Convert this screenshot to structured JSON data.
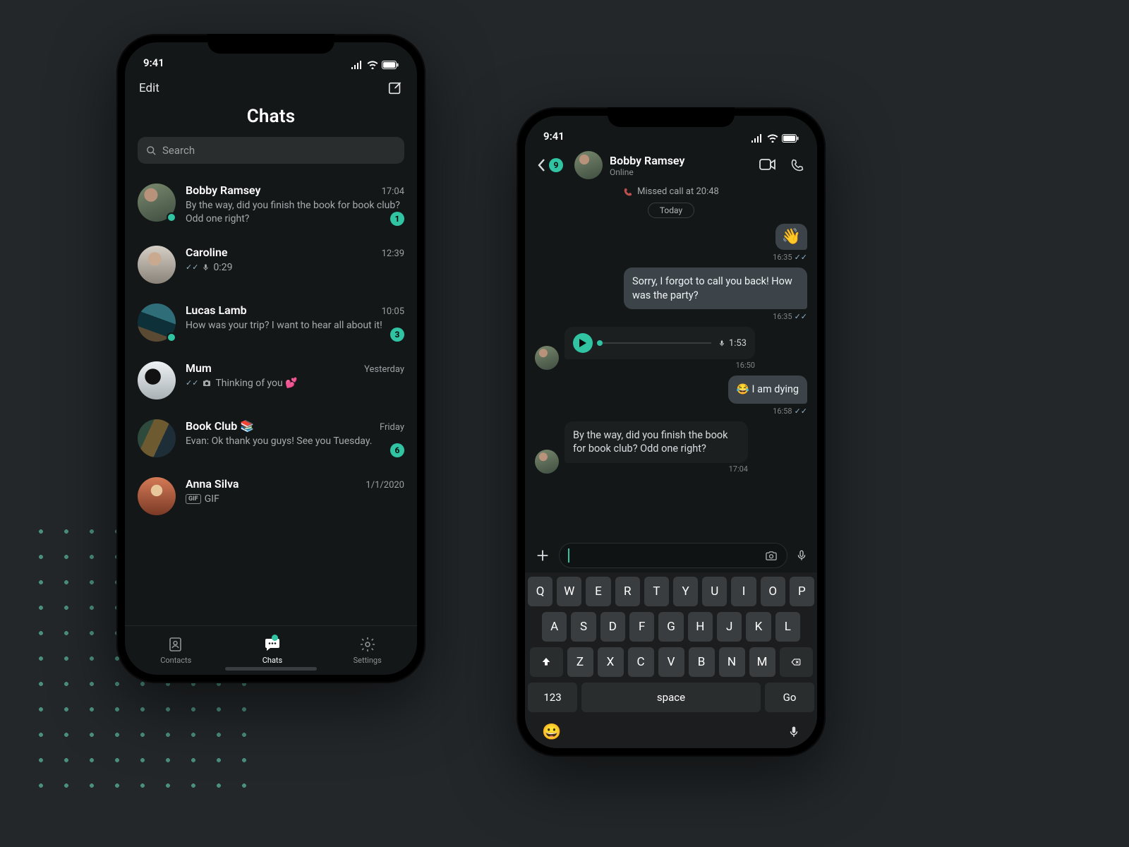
{
  "status_time": "9:41",
  "screen1": {
    "edit": "Edit",
    "title": "Chats",
    "search_placeholder": "Search",
    "tabs": {
      "contacts": "Contacts",
      "chats": "Chats",
      "settings": "Settings"
    },
    "chats": [
      {
        "name": "Bobby Ramsey",
        "time": "17:04",
        "preview": "By the way, did you finish the book for book club? Odd one right?",
        "badge": "1",
        "presence": true
      },
      {
        "name": "Caroline",
        "time": "12:39",
        "preview": "0:29"
      },
      {
        "name": "Lucas Lamb",
        "time": "10:05",
        "preview": "How was your trip? I want to hear all about it!",
        "badge": "3",
        "presence": true
      },
      {
        "name": "Mum",
        "time": "Yesterday",
        "preview": "Thinking of you 💕"
      },
      {
        "name": "Book Club 📚",
        "time": "Friday",
        "preview": "Evan: Ok thank you guys! See you Tuesday.",
        "badge": "6"
      },
      {
        "name": "Anna Silva",
        "time": "1/1/2020",
        "preview": "GIF"
      }
    ]
  },
  "screen2": {
    "back_count": "9",
    "name": "Bobby Ramsey",
    "status": "Online",
    "missed": "Missed call at 20:48",
    "day_label": "Today",
    "m_wave": "👋",
    "t_wave": "16:35",
    "m_sorry": "Sorry, I forgot to call you back! How was the party?",
    "t_sorry": "16:35",
    "voice_dur": "1:53",
    "t_voice": "16:50",
    "m_dying": "😂 I am dying",
    "t_dying": "16:58",
    "m_book": "By the way, did you finish the book for book club? Odd one right?",
    "t_book": "17:04",
    "keys_r1": [
      "Q",
      "W",
      "E",
      "R",
      "T",
      "Y",
      "U",
      "I",
      "O",
      "P"
    ],
    "keys_r2": [
      "A",
      "S",
      "D",
      "F",
      "G",
      "H",
      "J",
      "K",
      "L"
    ],
    "keys_r3": [
      "Z",
      "X",
      "C",
      "V",
      "B",
      "N",
      "M"
    ],
    "key_123": "123",
    "key_space": "space",
    "key_go": "Go"
  }
}
